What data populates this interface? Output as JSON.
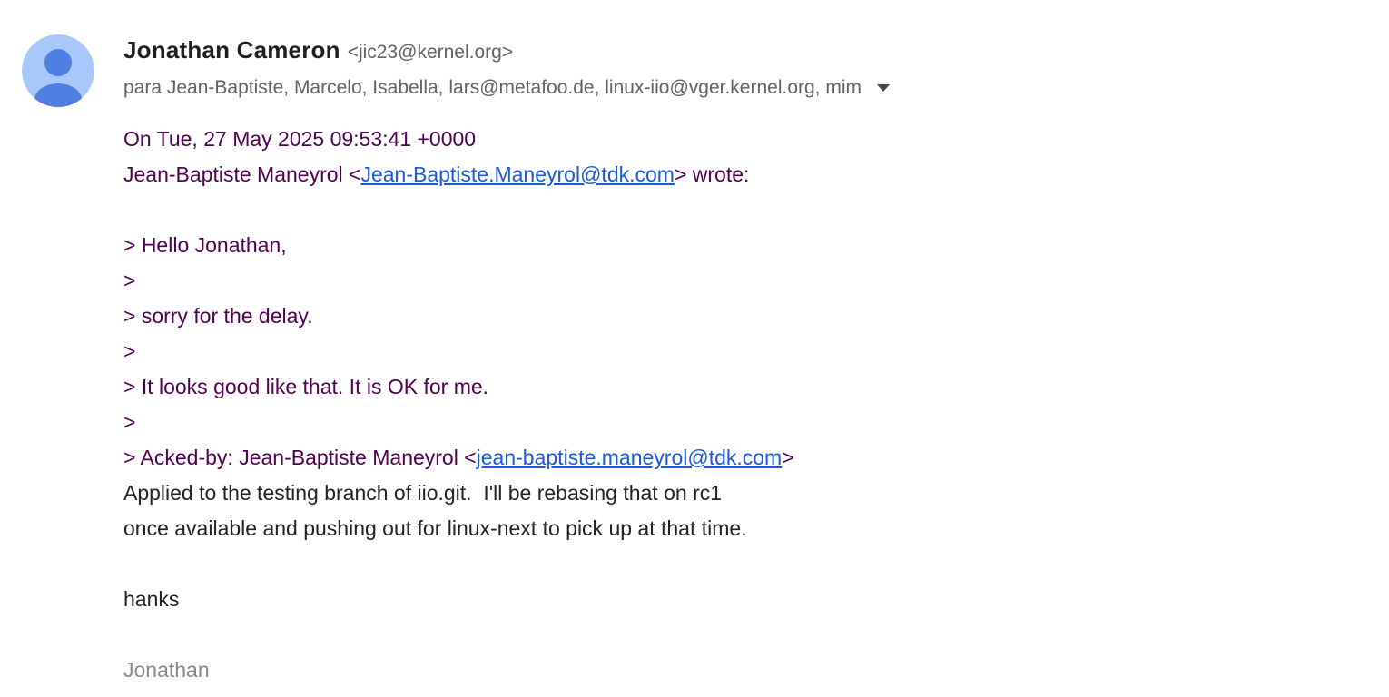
{
  "sender": {
    "name": "Jonathan Cameron",
    "email": "<jic23@kernel.org>"
  },
  "recipients": {
    "text": "para Jean-Baptiste, Marcelo, Isabella, lars@metafoo.de, linux-iio@vger.kernel.org, mim"
  },
  "icons": {
    "avatar": "person-avatar-icon",
    "details": "caret-down-icon"
  },
  "colors": {
    "quote": "#500050",
    "link": "#1a5ad7",
    "body": "#222222",
    "signature": "#888888",
    "avatar_bg": "#a8c7fa",
    "avatar_fg": "#4f7fe0"
  },
  "body": {
    "attribution_date": "On Tue, 27 May 2025 09:53:41 +0000",
    "attribution_name_prefix": "Jean-Baptiste Maneyrol <",
    "attribution_link": "Jean-Baptiste.Maneyrol@tdk.com",
    "attribution_suffix": "> wrote:",
    "quote_1": "> Hello Jonathan,",
    "quote_2": ">",
    "quote_3": "> sorry for the delay.",
    "quote_4": ">",
    "quote_5": "> It looks good like that. It is OK for me.",
    "quote_6": ">",
    "quote_7_prefix": "> Acked-by: Jean-Baptiste Maneyrol <",
    "quote_7_link": "jean-baptiste.maneyrol@tdk.com",
    "quote_7_suffix": ">",
    "reply_1": "Applied to the testing branch of iio.git.  I'll be rebasing that on rc1",
    "reply_2": "once available and pushing out for linux-next to pick up at that time.",
    "reply_3": "hanks",
    "signature": "Jonathan"
  }
}
